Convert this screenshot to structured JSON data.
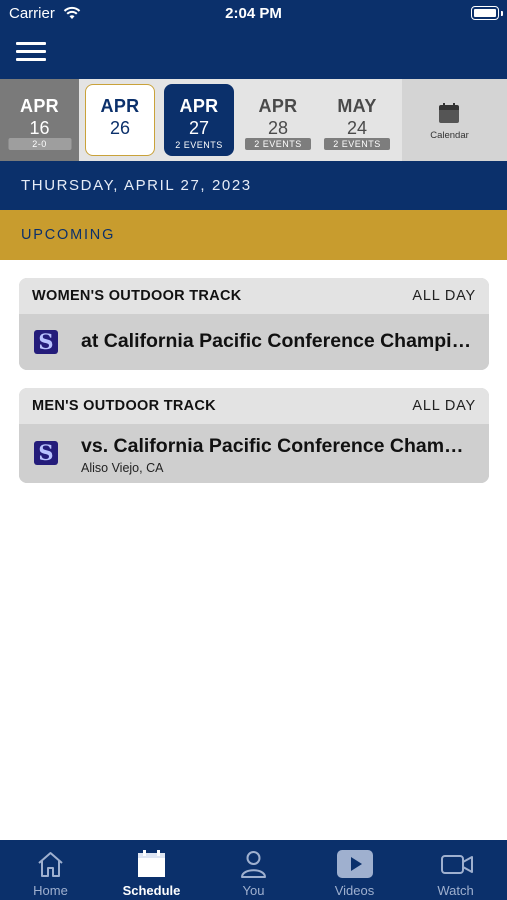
{
  "status_bar": {
    "carrier": "Carrier",
    "time": "2:04 PM"
  },
  "dates": [
    {
      "month": "APR",
      "day": "16",
      "tag": "2-0",
      "state": "past"
    },
    {
      "month": "APR",
      "day": "26",
      "tag": "",
      "state": "today"
    },
    {
      "month": "APR",
      "day": "27",
      "tag": "2 EVENTS",
      "state": "selected"
    },
    {
      "month": "APR",
      "day": "28",
      "tag": "2 EVENTS",
      "state": "upcoming"
    },
    {
      "month": "MAY",
      "day": "24",
      "tag": "2 EVENTS",
      "state": "upcoming"
    }
  ],
  "calendar_label": "Calendar",
  "selected_date_label": "THURSDAY, APRIL 27, 2023",
  "section_label": "UPCOMING",
  "events": [
    {
      "sport": "WOMEN'S OUTDOOR TRACK",
      "time": "ALL DAY",
      "title": "at California Pacific Conference Championships",
      "location": "",
      "logo_letter": "S"
    },
    {
      "sport": "MEN'S OUTDOOR TRACK",
      "time": "ALL DAY",
      "title": "vs. California Pacific Conference Championships",
      "location": "Aliso Viejo, CA",
      "logo_letter": "S"
    }
  ],
  "tabs": [
    {
      "label": "Home",
      "icon": "home-icon"
    },
    {
      "label": "Schedule",
      "icon": "calendar-icon",
      "active": true
    },
    {
      "label": "You",
      "icon": "person-icon"
    },
    {
      "label": "Videos",
      "icon": "play-icon"
    },
    {
      "label": "Watch",
      "icon": "video-camera-icon"
    }
  ],
  "colors": {
    "navy": "#0b306b",
    "gold": "#c89c2e",
    "strip": "#e4e4e4"
  }
}
